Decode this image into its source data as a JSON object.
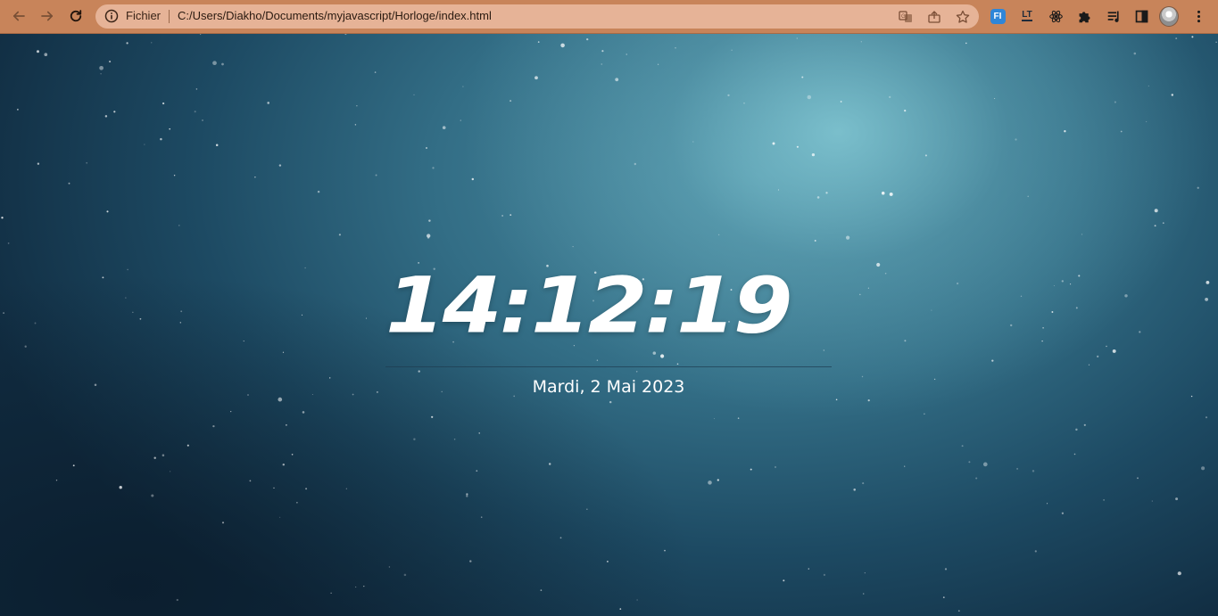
{
  "browser": {
    "nav": {
      "back_icon": "arrow-left-icon",
      "forward_icon": "arrow-right-icon",
      "reload_icon": "reload-icon"
    },
    "omnibox": {
      "scheme_label": "Fichier",
      "url": "C:/Users/Diakho/Documents/myjavascript/Horloge/index.html",
      "icons": [
        "translate-icon",
        "share-icon",
        "star-icon"
      ]
    },
    "extensions": {
      "fi_badge": "FI",
      "lt_badge": "LT",
      "icons": [
        "react-icon",
        "puzzle-icon",
        "playlist-icon",
        "sidepanel-icon",
        "avatar",
        "kebab-menu-icon"
      ]
    },
    "colors": {
      "toolbar": "#c8845a",
      "omnibox": "#e6b397"
    }
  },
  "page": {
    "clock": {
      "time": "14:12:19",
      "date": "Mardi, 2 Mai 2023"
    },
    "colors": {
      "background_dark": "#112d42",
      "background_light": "#8cd2dc",
      "text": "#ffffff"
    }
  }
}
